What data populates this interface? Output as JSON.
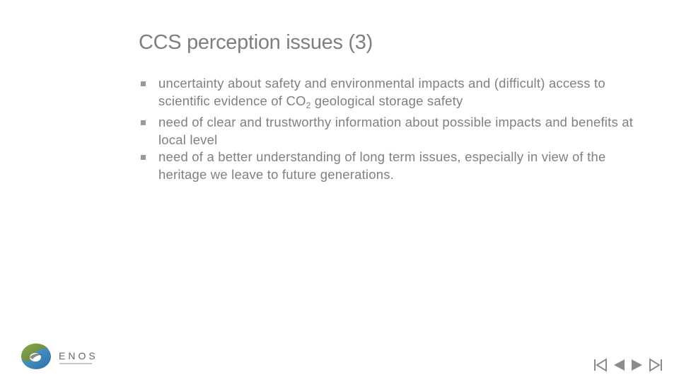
{
  "slide": {
    "title": "CCS perception issues (3)",
    "bullets": [
      {
        "text_before": "uncertainty about safety and environmental impacts and (difficult) access to scientific evidence of CO",
        "subscript": "2",
        "text_after": " geological storage safety"
      },
      {
        "text": "need of clear and trustworthy information about possible impacts and benefits at local level"
      },
      {
        "text": "need of a better understanding of long term issues, especially in view of the heritage we leave to future generations."
      }
    ]
  },
  "logo": {
    "name": "ENOS"
  },
  "navigation": {
    "buttons": [
      {
        "name": "first-slide",
        "icon": "skip-to-first-icon"
      },
      {
        "name": "previous-slide",
        "icon": "triangle-left-icon"
      },
      {
        "name": "next-slide",
        "icon": "triangle-right-icon"
      },
      {
        "name": "last-slide",
        "icon": "skip-to-last-icon"
      }
    ]
  },
  "colors": {
    "text": "#7f7f7f",
    "logo_green": "#7a9a3a",
    "logo_blue": "#3a7fb5",
    "nav_gray": "#8c8c8c"
  }
}
